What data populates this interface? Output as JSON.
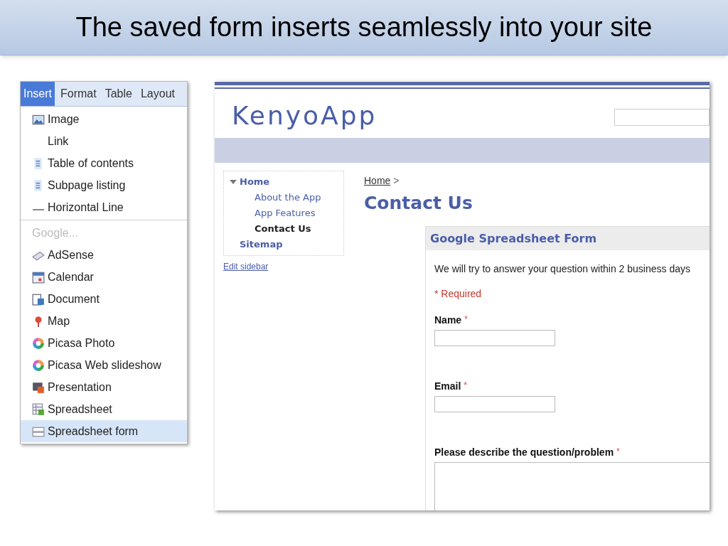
{
  "slide_title": "The saved form inserts seamlessly into your site",
  "menu": {
    "tabs": [
      {
        "label": "Insert",
        "selected": true
      },
      {
        "label": "Format",
        "selected": false
      },
      {
        "label": "Table",
        "selected": false
      },
      {
        "label": "Layout",
        "selected": false
      }
    ],
    "sections": [
      {
        "items": [
          {
            "kind": "item",
            "label": "Image",
            "selected": false
          },
          {
            "kind": "item",
            "label": "Link",
            "selected": false
          },
          {
            "kind": "item",
            "label": "Table of contents",
            "selected": false
          },
          {
            "kind": "item",
            "label": "Subpage listing",
            "selected": false
          },
          {
            "kind": "item",
            "label": "Horizontal Line",
            "selected": false
          }
        ]
      },
      {
        "items": [
          {
            "kind": "heading",
            "label": "Google..."
          },
          {
            "kind": "item",
            "label": "AdSense",
            "selected": false
          },
          {
            "kind": "item",
            "label": "Calendar",
            "selected": false
          },
          {
            "kind": "item",
            "label": "Document",
            "selected": false
          },
          {
            "kind": "item",
            "label": "Map",
            "selected": false
          },
          {
            "kind": "item",
            "label": "Picasa Photo",
            "selected": false
          },
          {
            "kind": "item",
            "label": "Picasa Web slideshow",
            "selected": false
          },
          {
            "kind": "item",
            "label": "Presentation",
            "selected": false
          },
          {
            "kind": "item",
            "label": "Spreadsheet",
            "selected": false
          },
          {
            "kind": "item",
            "label": "Spreadsheet form",
            "selected": true
          }
        ]
      }
    ]
  },
  "site": {
    "title": "KenyoApp",
    "sidebar": {
      "items": [
        {
          "label": "Home",
          "expanded": true,
          "selected": false,
          "children": [
            {
              "label": "About the App",
              "selected": false
            },
            {
              "label": "App Features",
              "selected": false
            },
            {
              "label": "Contact Us",
              "selected": true
            }
          ]
        },
        {
          "label": "Sitemap",
          "selected": false
        }
      ],
      "edit_link": "Edit sidebar"
    },
    "breadcrumb": {
      "link": "Home",
      "separator": ">"
    },
    "page_title": "Contact Us",
    "form": {
      "title": "Google Spreadsheet Form",
      "description": "We will try to answer your question within 2 business days",
      "required_note": "* Required",
      "fields": [
        {
          "kind": "text",
          "label": "Name",
          "required_mark": "*"
        },
        {
          "kind": "text",
          "label": "Email",
          "required_mark": "*"
        },
        {
          "kind": "textarea",
          "label": "Please describe the question/problem",
          "required_mark": "*"
        }
      ]
    }
  }
}
